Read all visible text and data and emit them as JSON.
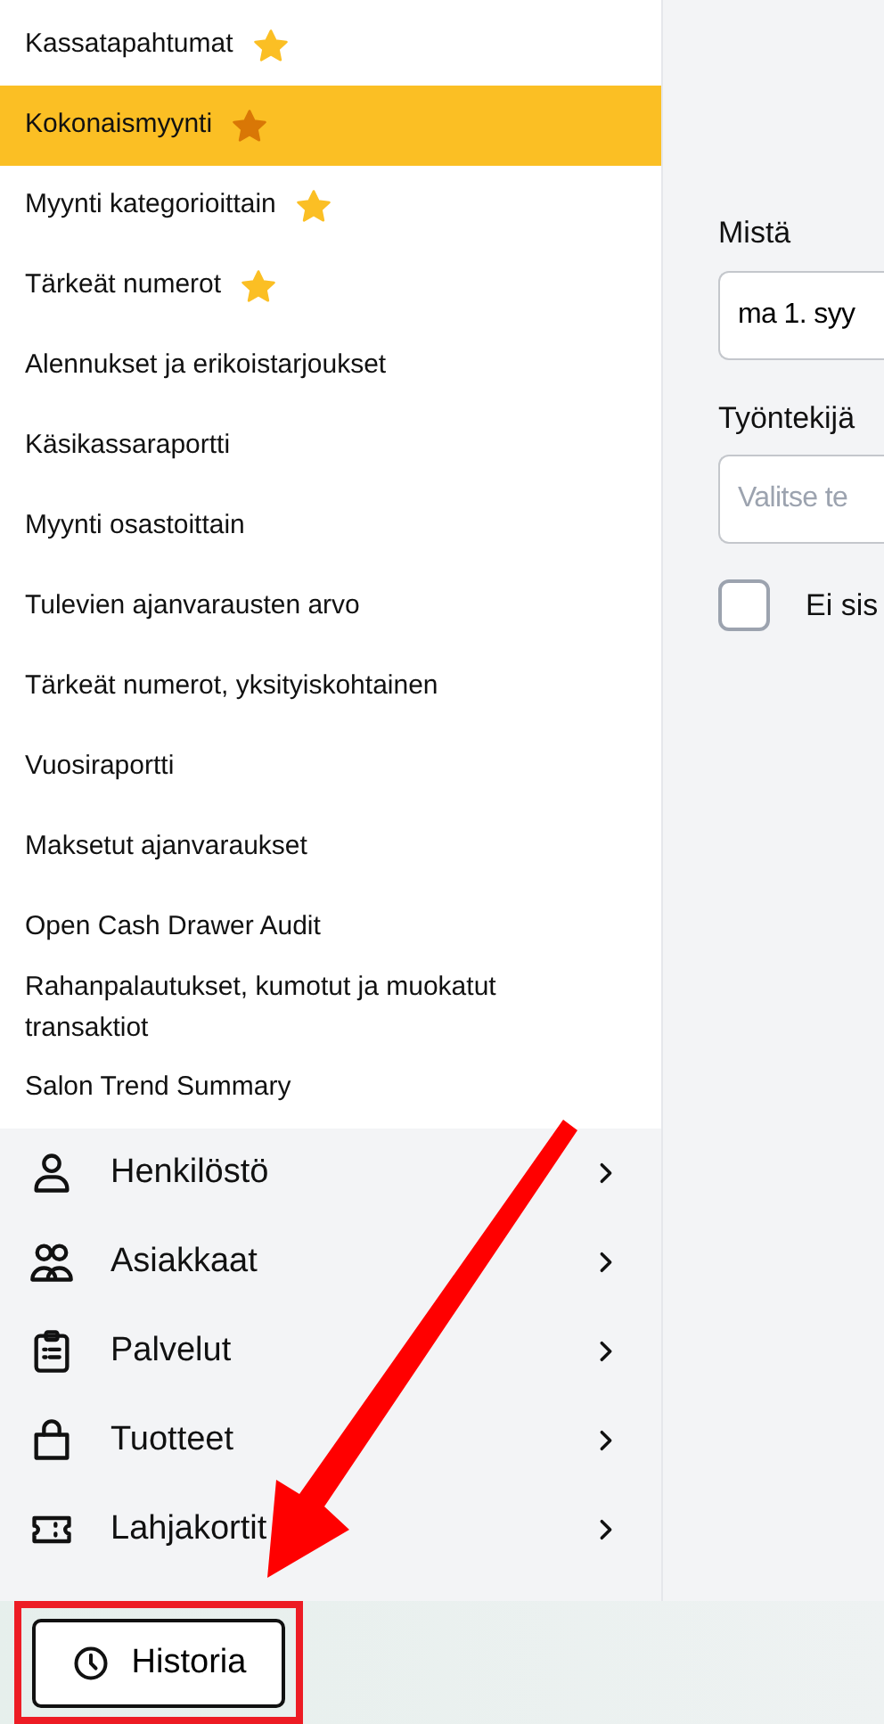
{
  "reports": [
    {
      "label": "Kassatapahtumat",
      "favorite": true,
      "selected": false
    },
    {
      "label": "Kokonaismyynti",
      "favorite": true,
      "selected": true
    },
    {
      "label": "Myynti kategorioittain",
      "favorite": true,
      "selected": false
    },
    {
      "label": "Tärkeät numerot",
      "favorite": true,
      "selected": false
    },
    {
      "label": "Alennukset ja erikoistarjoukset",
      "favorite": false,
      "selected": false
    },
    {
      "label": "Käsikassaraportti",
      "favorite": false,
      "selected": false
    },
    {
      "label": "Myynti osastoittain",
      "favorite": false,
      "selected": false
    },
    {
      "label": "Tulevien ajanvarausten arvo",
      "favorite": false,
      "selected": false
    },
    {
      "label": "Tärkeät numerot, yksityiskohtainen",
      "favorite": false,
      "selected": false
    },
    {
      "label": "Vuosiraportti",
      "favorite": false,
      "selected": false
    },
    {
      "label": "Maksetut ajanvaraukset",
      "favorite": false,
      "selected": false
    },
    {
      "label": "Open Cash Drawer Audit",
      "favorite": false,
      "selected": false
    },
    {
      "label": "Rahanpalautukset, kumotut ja muokatut transaktiot",
      "favorite": false,
      "selected": false
    },
    {
      "label": "Salon Trend Summary",
      "favorite": false,
      "selected": false
    }
  ],
  "nav": [
    {
      "label": "Henkilöstö",
      "kind": "person"
    },
    {
      "label": "Asiakkaat",
      "kind": "people"
    },
    {
      "label": "Palvelut",
      "kind": "clipboard"
    },
    {
      "label": "Tuotteet",
      "kind": "bag"
    },
    {
      "label": "Lahjakortit",
      "kind": "ticket"
    }
  ],
  "form": {
    "from_label": "Mistä",
    "from_value": "ma 1. syy",
    "employee_label": "Työntekijä",
    "employee_placeholder": "Valitse te",
    "checkbox_label": "Ei sis",
    "checkbox_checked": false
  },
  "footer": {
    "button": "Historia",
    "highlighted": true
  },
  "annotation": {
    "arrow": true
  }
}
